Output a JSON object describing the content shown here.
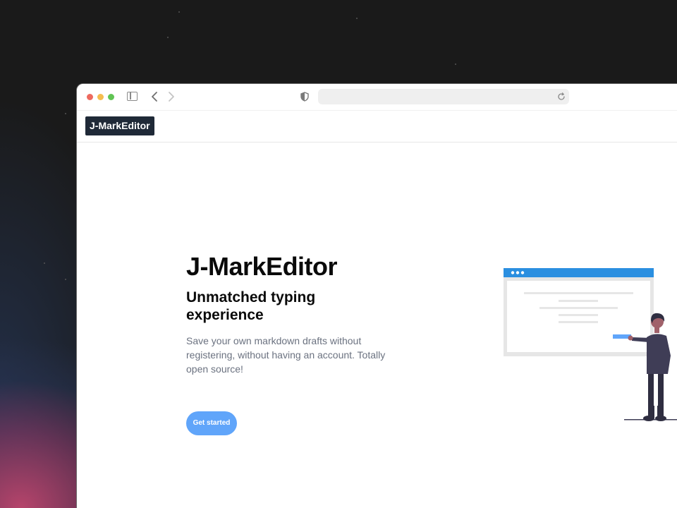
{
  "browser": {
    "address_value": ""
  },
  "navbar": {
    "logo_text": "J-MarkEditor"
  },
  "hero": {
    "title": "J-MarkEditor",
    "subtitle": "Unmatched typing experience",
    "description": "Save your own markdown drafts without registering, without having an account. Totally open source!",
    "cta_label": "Get started"
  },
  "colors": {
    "accent": "#60a5fa",
    "logo_bg": "#1f2937",
    "illustration_bar": "#2b8fe0"
  },
  "icons": [
    "sidebar-toggle-icon",
    "back-arrow-icon",
    "forward-arrow-icon",
    "shield-icon",
    "reload-icon",
    "person-presenting-illustration"
  ]
}
